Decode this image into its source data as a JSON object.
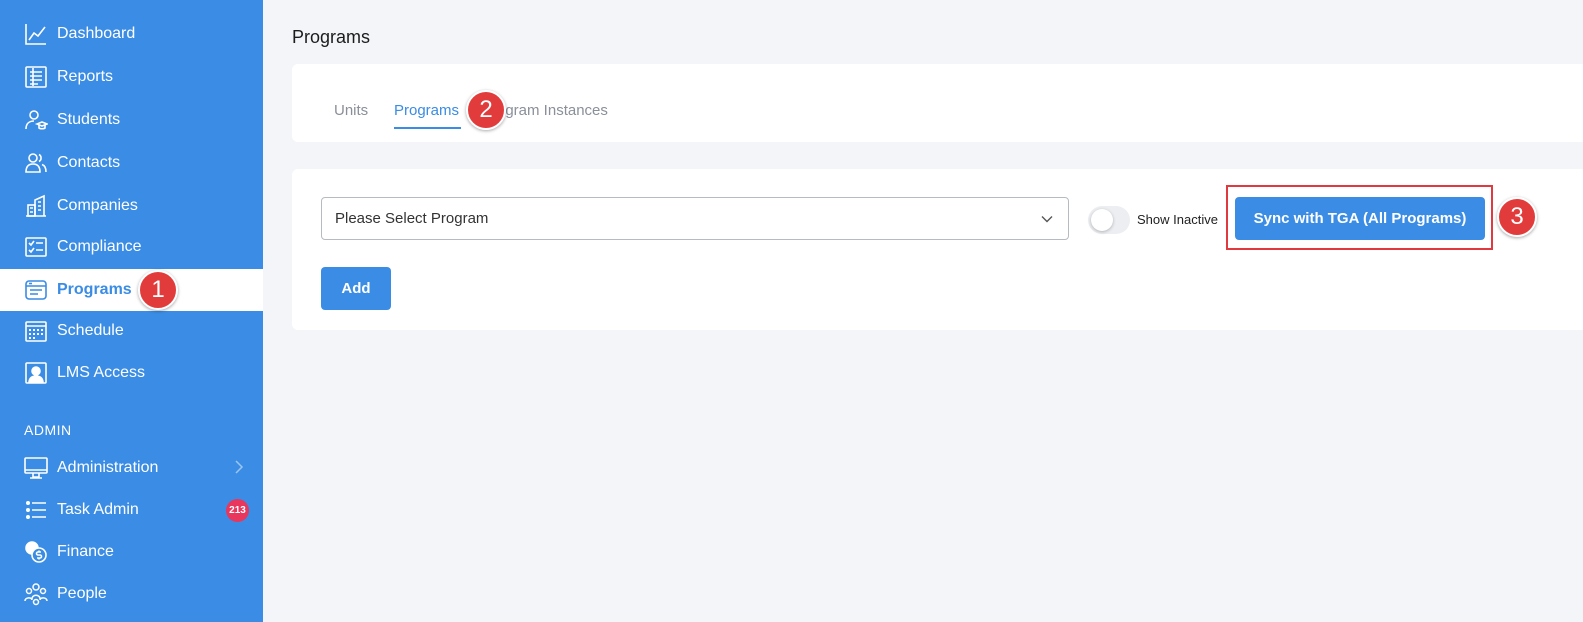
{
  "sidebar": {
    "items": [
      {
        "label": "Dashboard",
        "icon": "chart-line-icon"
      },
      {
        "label": "Reports",
        "icon": "report-list-icon"
      },
      {
        "label": "Students",
        "icon": "student-icon"
      },
      {
        "label": "Contacts",
        "icon": "contacts-icon"
      },
      {
        "label": "Companies",
        "icon": "building-icon"
      },
      {
        "label": "Compliance",
        "icon": "checklist-icon"
      },
      {
        "label": "Programs",
        "icon": "window-icon"
      },
      {
        "label": "Schedule",
        "icon": "calendar-grid-icon"
      },
      {
        "label": "LMS Access",
        "icon": "user-screen-icon"
      }
    ],
    "admin_label": "ADMIN",
    "admin_items": [
      {
        "label": "Administration",
        "icon": "monitor-icon"
      },
      {
        "label": "Task Admin",
        "icon": "list-icon",
        "badge": "213"
      },
      {
        "label": "Finance",
        "icon": "coins-icon"
      },
      {
        "label": "People",
        "icon": "people-group-icon"
      }
    ],
    "active": "Programs",
    "colors": {
      "background": "#3a8ce4",
      "active_background": "#ffffff",
      "badge": "#e8365d"
    }
  },
  "page": {
    "title": "Programs"
  },
  "tabs": [
    {
      "label": "Units"
    },
    {
      "label": "Programs"
    },
    {
      "label": "Program Instances"
    }
  ],
  "main": {
    "select_placeholder": "Please Select Program",
    "toggle_label": "Show Inactive",
    "sync_label": "Sync with TGA (All Programs)",
    "add_label": "Add"
  },
  "markers": [
    "1",
    "2",
    "3"
  ],
  "colors": {
    "accent": "#3a8ce4",
    "marker": "#e23b3b",
    "highlight": "#e0393f"
  }
}
